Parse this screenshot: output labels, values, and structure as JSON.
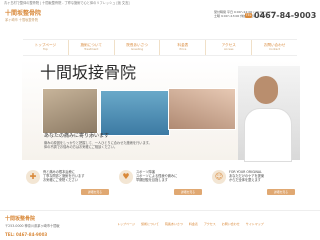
{
  "header": {
    "tagline": "青ヶ島村で整体の整骨院 | 十間坂整骨院 - 丁寧な施術で心と体のリフレッシュ [仮 文言]",
    "logo": "十間坂整骨院",
    "logo_sub": "茅ヶ崎市 十間坂整骨院",
    "hours_line1": "受付時間 平日 9:00〜12:00 / 15:00〜20:00",
    "hours_line2": "土曜 9:00〜13:00 休診日 日曜・祝日",
    "tel_label": "TEL",
    "tel": "0467-84-9003"
  },
  "nav": {
    "items": [
      {
        "jp": "トップページ",
        "en": "Top"
      },
      {
        "jp": "施術について",
        "en": "Treatment"
      },
      {
        "jp": "院長あいさつ",
        "en": "Greeting"
      },
      {
        "jp": "料金表",
        "en": "Price"
      },
      {
        "jp": "アクセス",
        "en": "Access"
      },
      {
        "jp": "お問い合わせ",
        "en": "Contact"
      }
    ]
  },
  "hero": {
    "title": "十間坂接骨院",
    "subtitle": "あなたの痛みに寄り添います",
    "desc1": "痛みの原因をしっかりと把握して、一人ひとりに合わせた施術を行います。",
    "desc2": "体の不調でお悩みの方はお気軽にご相談ください。"
  },
  "cards": [
    {
      "icon": "✚",
      "text1": "骨と痛みの根本治療に",
      "text2": "丁寧な問診と施術を行います",
      "text3": "お気軽にご来院ください",
      "button": "詳細を見る"
    },
    {
      "icon": "♥",
      "text1": "スポーツ障害",
      "text2": "スポーツによる怪我や痛みに",
      "text3": "早期回復を目指します",
      "button": "詳細を見る"
    },
    {
      "icon": "☺",
      "text1": "FOR YOUR ORIGINAL",
      "text2": "あなただけのケアを提案",
      "text3": "からだ全体を整えます",
      "button": "詳細を見る"
    }
  ],
  "footer": {
    "logo": "十間坂整骨院",
    "address": "〒253-0000 神奈川県茅ヶ崎市十間坂",
    "tel": "TEL: 0467-84-9003",
    "links": [
      "トップページ",
      "施術について",
      "院長あいさつ",
      "料金表",
      "アクセス",
      "お問い合わせ",
      "サイトマップ"
    ]
  }
}
